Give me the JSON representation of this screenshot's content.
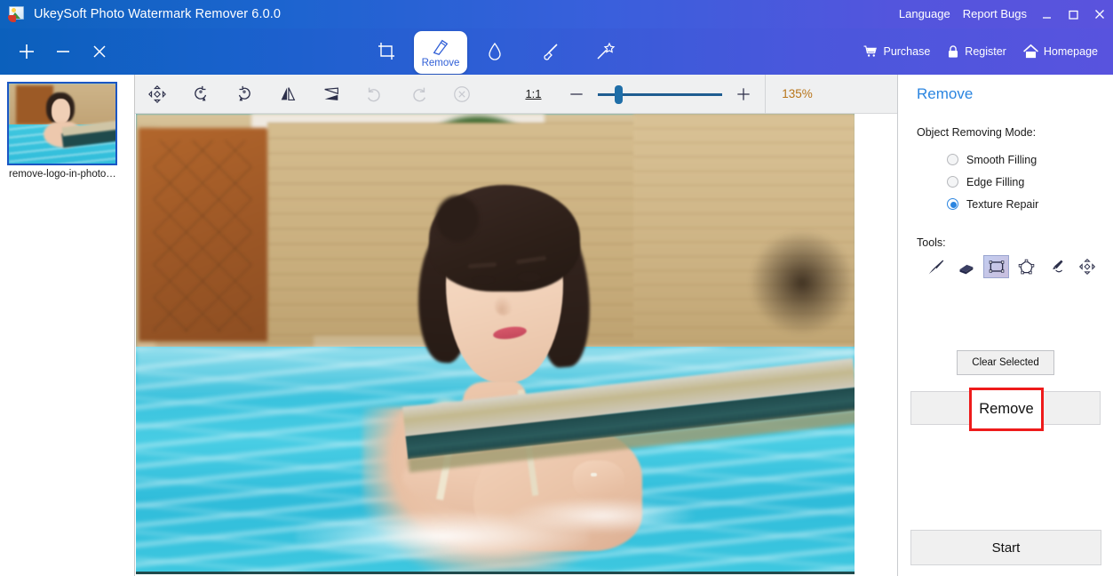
{
  "titlebar": {
    "logo_icon": "photo-app-logo-icon",
    "title": "UkeySoft Photo Watermark Remover 6.0.0",
    "links": [
      {
        "label": "Language",
        "name": "language-menu"
      },
      {
        "label": "Report Bugs",
        "name": "report-bugs-link"
      }
    ],
    "window_buttons": [
      {
        "name": "minimize-button",
        "icon": "minimize-icon"
      },
      {
        "name": "maximize-button",
        "icon": "maximize-icon"
      },
      {
        "name": "close-button",
        "icon": "close-icon"
      }
    ],
    "gradient_from": "#0e62bd",
    "gradient_to": "#5a53dd"
  },
  "mainbar": {
    "left_ops": [
      {
        "name": "add-file-button",
        "icon": "plus-icon"
      },
      {
        "name": "remove-file-button",
        "icon": "minus-icon"
      },
      {
        "name": "clear-files-button",
        "icon": "close-icon"
      }
    ],
    "tools": [
      {
        "label": "",
        "name": "tab-crop",
        "icon": "crop-icon",
        "active": false
      },
      {
        "label": "Remove",
        "name": "tab-remove",
        "icon": "eraser-icon",
        "active": true
      },
      {
        "label": "",
        "name": "tab-watermark",
        "icon": "droplet-icon",
        "active": false
      },
      {
        "label": "",
        "name": "tab-retouch",
        "icon": "brush-icon",
        "active": false
      },
      {
        "label": "",
        "name": "tab-magic",
        "icon": "magic-wand-icon",
        "active": false
      }
    ],
    "right_ops": [
      {
        "label": "Purchase",
        "name": "purchase-button",
        "icon": "cart-icon"
      },
      {
        "label": "Register",
        "name": "register-button",
        "icon": "lock-icon"
      },
      {
        "label": "Homepage",
        "name": "homepage-button",
        "icon": "home-icon"
      }
    ]
  },
  "sidebar": {
    "thumbnail": {
      "name": "thumbnail-item",
      "label": "remove-logo-in-photo…",
      "selected": true
    }
  },
  "imagebar": {
    "buttons": [
      {
        "name": "pan-tool-button",
        "icon": "move-icon",
        "disabled": false
      },
      {
        "name": "rotate-left-button",
        "icon": "rotate-ccw-icon",
        "disabled": false
      },
      {
        "name": "rotate-right-button",
        "icon": "rotate-cw-icon",
        "disabled": false
      },
      {
        "name": "flip-horizontal-button",
        "icon": "flip-horizontal-icon",
        "disabled": false
      },
      {
        "name": "flip-vertical-button",
        "icon": "flip-vertical-icon",
        "disabled": false
      },
      {
        "name": "undo-button",
        "icon": "undo-icon",
        "disabled": true
      },
      {
        "name": "redo-button",
        "icon": "redo-icon",
        "disabled": true
      },
      {
        "name": "reset-button",
        "icon": "cancel-circle-icon",
        "disabled": true
      }
    ],
    "actual_size_label": "1:1",
    "zoom_out_icon": "minus-icon",
    "zoom_in_icon": "plus-icon",
    "zoom_value": "135%",
    "zoom_value_color": "#b8751a",
    "slider_position_percent": 15
  },
  "right_panel": {
    "title": "Remove",
    "title_color": "#2b85e0",
    "mode_label": "Object Removing Mode:",
    "modes": [
      {
        "label": "Smooth Filling",
        "selected": false,
        "name": "radio-smooth-filling"
      },
      {
        "label": "Edge Filling",
        "selected": false,
        "name": "radio-edge-filling"
      },
      {
        "label": "Texture Repair",
        "selected": true,
        "name": "radio-texture-repair"
      }
    ],
    "tools_label": "Tools:",
    "tools": [
      {
        "name": "brush-tool-button",
        "icon": "paintbrush-icon",
        "selected": false
      },
      {
        "name": "eraser-tool-button",
        "icon": "eraser-icon",
        "selected": false
      },
      {
        "name": "rectangle-tool-button",
        "icon": "rectangle-select-icon",
        "selected": true
      },
      {
        "name": "polygon-tool-button",
        "icon": "polygon-select-icon",
        "selected": false
      },
      {
        "name": "pen-tool-button",
        "icon": "pen-icon",
        "selected": false
      },
      {
        "name": "move-tool-button",
        "icon": "move-icon",
        "selected": false
      }
    ],
    "clear_selected_label": "Clear Selected",
    "remove_label": "Remove",
    "remove_highlight_color": "#ee1b1b",
    "start_label": "Start"
  }
}
